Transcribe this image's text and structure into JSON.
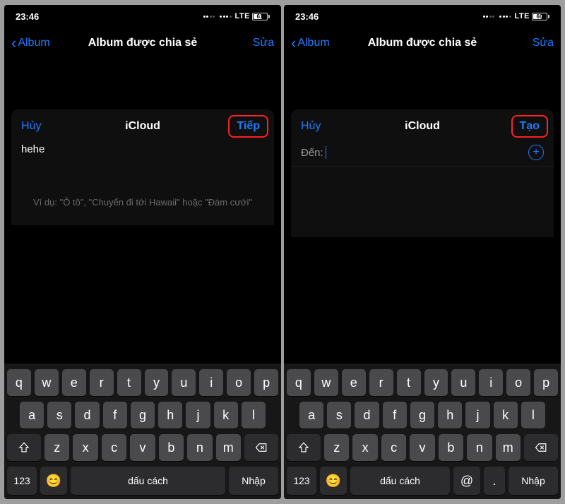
{
  "screens": [
    {
      "status": {
        "time": "23:46",
        "lte": "LTE",
        "battery": "61"
      },
      "nav": {
        "back": "Album",
        "title": "Album được chia sẻ",
        "right": "Sửa"
      },
      "modal": {
        "cancel": "Hủy",
        "title": "iCloud",
        "action": "Tiếp",
        "input_value": "hehe",
        "hint": "Ví dụ: \"Ô tô\", \"Chuyến đi tới Hawaii\" hoặc \"Đám cưới\""
      },
      "keyboard": {
        "row1": [
          "q",
          "w",
          "e",
          "r",
          "t",
          "y",
          "u",
          "i",
          "o",
          "p"
        ],
        "row2": [
          "a",
          "s",
          "d",
          "f",
          "g",
          "h",
          "j",
          "k",
          "l"
        ],
        "row3": [
          "z",
          "x",
          "c",
          "v",
          "b",
          "n",
          "m"
        ],
        "numKey": "123",
        "space": "dấu cách",
        "enter": "Nhập"
      }
    },
    {
      "status": {
        "time": "23:46",
        "lte": "LTE",
        "battery": "60"
      },
      "nav": {
        "back": "Album",
        "title": "Album được chia sẻ",
        "right": "Sửa"
      },
      "modal": {
        "cancel": "Hủy",
        "title": "iCloud",
        "action": "Tạo",
        "to_label": "Đến:"
      },
      "keyboard": {
        "row1": [
          "q",
          "w",
          "e",
          "r",
          "t",
          "y",
          "u",
          "i",
          "o",
          "p"
        ],
        "row2": [
          "a",
          "s",
          "d",
          "f",
          "g",
          "h",
          "j",
          "k",
          "l"
        ],
        "row3": [
          "z",
          "x",
          "c",
          "v",
          "b",
          "n",
          "m"
        ],
        "numKey": "123",
        "space": "dấu cách",
        "at": "@",
        "dot": ".",
        "enter": "Nhập"
      }
    }
  ]
}
